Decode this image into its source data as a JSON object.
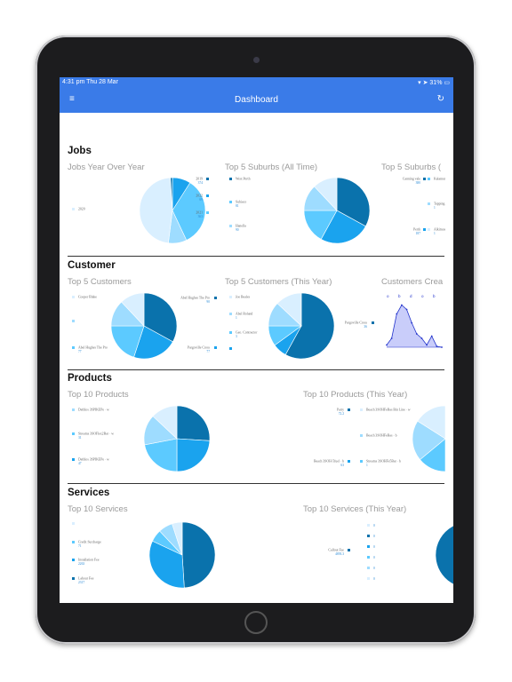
{
  "status": {
    "time": "4:31 pm  Thu 28 Mar",
    "battery": "31%"
  },
  "nav": {
    "title": "Dashboard",
    "menu_icon": "menu-icon",
    "refresh_icon": "refresh-icon"
  },
  "colors": {
    "nav": "#3a7be8",
    "slices": [
      "#0a72ac",
      "#1aa3ee",
      "#5ccaff",
      "#9edcff",
      "#d9efff"
    ]
  },
  "sections": {
    "jobs": {
      "title": "Jobs",
      "c1": "Jobs Year Over Year",
      "c2": "Top 5 Suburbs (All Time)",
      "c3": "Top 5 Suburbs ("
    },
    "customer": {
      "title": "Customer",
      "c1": "Top 5 Customers",
      "c2": "Top 5 Customers (This Year)",
      "c3": "Customers Crea"
    },
    "products": {
      "title": "Products",
      "c1": "Top 10 Products",
      "c2": "Top 10 Products (This Year)"
    },
    "services": {
      "title": "Services",
      "c1": "Top 10 Services",
      "c2": "Top 10 Services (This Year)"
    }
  },
  "chart_data": [
    {
      "type": "pie",
      "title": "Jobs Year Over Year",
      "slices": [
        {
          "label": "2022",
          "value": "69",
          "pct": 0.09,
          "color": "#1aa3ee"
        },
        {
          "label": "2021",
          "value": "363",
          "pct": 0.34,
          "color": "#5ccaff"
        },
        {
          "label": "2020",
          "value": "2320",
          "pct": 0.09,
          "color": "#9edcff"
        },
        {
          "label": "2020",
          "value": "",
          "pct": 0.47,
          "color": "#d9efff"
        },
        {
          "label": "2019",
          "value": "374",
          "pct": 0.01,
          "color": "#0a72ac"
        }
      ]
    },
    {
      "type": "pie",
      "title": "Top 5 Suburbs (All Time)",
      "slices": [
        {
          "label": "West Perth",
          "value": "",
          "pct": 0.33,
          "color": "#0a72ac"
        },
        {
          "label": "",
          "value": "",
          "pct": 0.25,
          "color": "#1aa3ee"
        },
        {
          "label": "Subiaco",
          "value": "81",
          "pct": 0.17,
          "color": "#5ccaff"
        },
        {
          "label": "Hanella",
          "value": "90",
          "pct": 0.13,
          "color": "#9edcff"
        },
        {
          "label": "",
          "value": "",
          "pct": 0.12,
          "color": "#d9efff"
        }
      ]
    },
    {
      "type": "pie",
      "title": "Top 5 Suburbs (",
      "slices": [
        {
          "label": "Canning vale",
          "value": "380",
          "pct": 0.33,
          "color": "#0a72ac"
        },
        {
          "label": "Perth",
          "value": "187",
          "pct": 0.25,
          "color": "#1aa3ee"
        },
        {
          "label": "Kalamunda",
          "value": "",
          "pct": 0.17,
          "color": "#5ccaff"
        },
        {
          "label": "Tapping",
          "value": "1",
          "pct": 0.13,
          "color": "#9edcff"
        },
        {
          "label": "Alkimos",
          "value": "1",
          "pct": 0.12,
          "color": "#d9efff"
        }
      ]
    },
    {
      "type": "pie",
      "title": "Top 5 Customers",
      "slices": [
        {
          "label": "Abel Hughes The Pro",
          "value": "90",
          "pct": 0.33,
          "color": "#0a72ac"
        },
        {
          "label": "Pargoville Cross",
          "value": "77",
          "pct": 0.22,
          "color": "#1aa3ee"
        },
        {
          "label": "Abel Hughes The Pro",
          "value": "77",
          "pct": 0.2,
          "color": "#5ccaff"
        },
        {
          "label": "",
          "value": "",
          "pct": 0.13,
          "color": "#9edcff"
        },
        {
          "label": "Cooper Blake",
          "value": "",
          "pct": 0.12,
          "color": "#d9efff"
        }
      ]
    },
    {
      "type": "pie",
      "title": "Top 5 Customers (This Year)",
      "slices": [
        {
          "label": "Pargoville Cross",
          "value": "36",
          "pct": 0.58,
          "color": "#0a72ac"
        },
        {
          "label": "",
          "value": "",
          "pct": 0.07,
          "color": "#1aa3ee"
        },
        {
          "label": "Geo. Contractor",
          "value": "3",
          "pct": 0.1,
          "color": "#5ccaff"
        },
        {
          "label": "Abel Roland",
          "value": "1",
          "pct": 0.12,
          "color": "#9edcff"
        },
        {
          "label": "Joe Beales",
          "value": "",
          "pct": 0.13,
          "color": "#d9efff"
        }
      ]
    },
    {
      "type": "line",
      "title": "Customers Crea",
      "x_labels": [
        "o",
        "b",
        "d",
        "o",
        "b"
      ],
      "points": [
        0.05,
        0.2,
        0.75,
        0.95,
        0.85,
        0.55,
        0.3,
        0.2,
        0.05,
        0.25,
        0.02,
        0.0
      ],
      "color": "#2233cc",
      "fill": "#c9cdfa"
    },
    {
      "type": "pie",
      "title": "Top 10 Products",
      "slices": [
        {
          "label": "",
          "value": "",
          "pct": 0.26,
          "color": "#0a72ac"
        },
        {
          "label": "Dethlos 3SPIKEPe · w",
          "value": "47",
          "pct": 0.24,
          "color": "#1aa3ee"
        },
        {
          "label": "Streams 3SOFlex2Bar · w",
          "value": "31",
          "pct": 0.22,
          "color": "#5ccaff"
        },
        {
          "label": "Dethlos 3SPIKEPe · w",
          "value": "",
          "pct": 0.15,
          "color": "#9edcff"
        },
        {
          "label": "",
          "value": "",
          "pct": 0.13,
          "color": "#d9efff"
        }
      ]
    },
    {
      "type": "pie",
      "title": "Top 10 Products (This Year)",
      "slices": [
        {
          "label": "Party",
          "value": "72.2",
          "pct": 0.32,
          "color": "#0a72ac"
        },
        {
          "label": "Beach 3SOH-5fuel · b",
          "value": "63",
          "pct": 0.18,
          "color": "#1aa3ee"
        },
        {
          "label": "Streams 3SOHFe5Bar · b",
          "value": "1",
          "pct": 0.14,
          "color": "#5ccaff"
        },
        {
          "label": "Beach 3SOHFeBas · b",
          "value": "",
          "pct": 0.2,
          "color": "#9edcff"
        },
        {
          "label": "Beach 3SOHFeBas Bin Line · w",
          "value": "",
          "pct": 0.16,
          "color": "#d9efff"
        }
      ]
    },
    {
      "type": "pie",
      "title": "Top 10 Services",
      "slices": [
        {
          "label": "Labour Fee",
          "value": "2317",
          "pct": 0.49,
          "color": "#0a72ac"
        },
        {
          "label": "Installation Fee",
          "value": "2263",
          "pct": 0.33,
          "color": "#1aa3ee"
        },
        {
          "label": "Credit Surcharge",
          "value": "71",
          "pct": 0.06,
          "color": "#5ccaff"
        },
        {
          "label": "",
          "value": "",
          "pct": 0.07,
          "color": "#9edcff"
        },
        {
          "label": "",
          "value": "",
          "pct": 0.05,
          "color": "#d9efff"
        }
      ]
    },
    {
      "type": "pie",
      "title": "Top 10 Services (This Year)",
      "slices": [
        {
          "label": "Callout Fee",
          "value": "4893.3",
          "pct": 1.0,
          "color": "#0a72ac"
        }
      ],
      "legend_values": [
        "0",
        "0",
        "0",
        "0",
        "0",
        "0"
      ]
    }
  ]
}
